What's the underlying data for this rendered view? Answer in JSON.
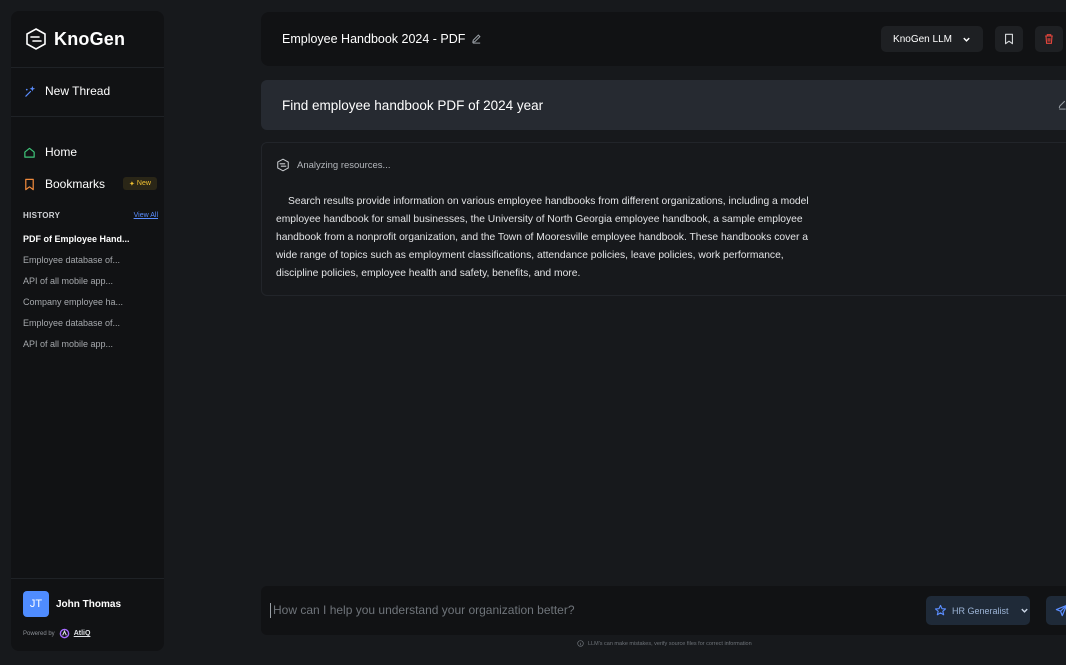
{
  "app": {
    "name": "KnoGen"
  },
  "sidebar": {
    "new_thread": "New Thread",
    "nav": [
      {
        "label": "Home",
        "icon": "home-icon"
      },
      {
        "label": "Bookmarks",
        "icon": "bookmark-icon",
        "badge": "New"
      }
    ],
    "history_title": "HISTORY",
    "view_all": "View All",
    "history": [
      "PDF of Employee Hand...",
      "Employee database of...",
      "API of all mobile app...",
      "Company employee ha...",
      "Employee database of...",
      "API of all mobile app..."
    ],
    "user": {
      "initials": "JT",
      "name": "John Thomas"
    },
    "powered_by": "Powered by",
    "powered_brand": "AtliQ"
  },
  "header": {
    "title": "Employee Handbook 2024 - PDF",
    "model": "KnoGen LLM"
  },
  "query": {
    "text": "Find employee handbook PDF of 2024 year"
  },
  "answer": {
    "status": "Analyzing resources...",
    "text": "Search results provide information on various employee handbooks from different organizations, including a model employee handbook for small businesses, the University of North Georgia employee handbook, a sample employee handbook from a nonprofit organization, and the Town of Mooresville employee handbook.    These handbooks cover a wide range of topics such as employment classifications, attendance policies, leave policies, work performance, discipline policies, employee health and safety, benefits, and more."
  },
  "composer": {
    "placeholder": "How can I help you understand your organization better?",
    "value": "",
    "role": "HR Generalist"
  },
  "disclaimer": "LLM's can make mistakes, verify source files for correct information",
  "colors": {
    "background": "#17191c",
    "panel": "#111214",
    "accent": "#4f8cff",
    "home_icon": "#3fc57a",
    "bookmark_icon": "#f08a3c",
    "delete_icon": "#e2453c"
  }
}
